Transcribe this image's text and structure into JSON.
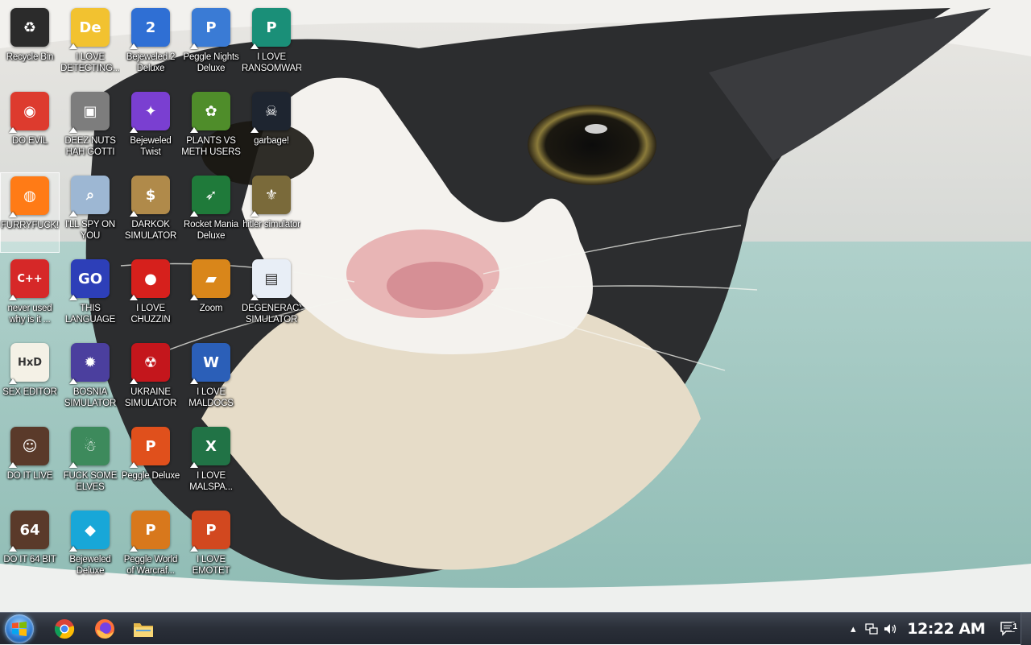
{
  "desktop": {
    "icons": [
      {
        "label": "Recycle Bin",
        "icon": "recycle-bin-icon",
        "color": "#2b2b2b",
        "glyph": "♻"
      },
      {
        "label": "DO EVIL",
        "icon": "chrome-icon",
        "color": "#dd3b2e",
        "glyph": "◉"
      },
      {
        "label": "FURRYFUCK!",
        "icon": "firefox-icon",
        "color": "#ff7b16",
        "glyph": "◍"
      },
      {
        "label": "never used\nwhy is it ...",
        "icon": "devcpp-icon",
        "color": "#d62828",
        "glyph": "C++"
      },
      {
        "label": "SEX EDITOR",
        "icon": "hxd-icon",
        "color": "#f4f1e6",
        "glyph": "HxD"
      },
      {
        "label": "DO IT LIVE",
        "icon": "portrait-icon",
        "color": "#5a3a2a",
        "glyph": "☺"
      },
      {
        "label": "DO IT 64 BIT",
        "icon": "portrait-64-icon",
        "color": "#5a3a2a",
        "glyph": "64"
      },
      {
        "label": "I LOVE\nDETECTING...",
        "icon": "detect-it-easy-icon",
        "color": "#f2c230",
        "glyph": "De"
      },
      {
        "label": "DEEZ NUTS\nHAH GOTTI",
        "icon": "windows-stack-icon",
        "color": "#7d7d7d",
        "glyph": "▣"
      },
      {
        "label": "I'LL SPY ON\nYOU",
        "icon": "spy-monitor-icon",
        "color": "#9db7d3",
        "glyph": "⌕"
      },
      {
        "label": "THIS\nLANGUAGE ...",
        "icon": "goland-icon",
        "color": "#2d3fb8",
        "glyph": "GO"
      },
      {
        "label": "BOSNIA\nSIMULATOR",
        "icon": "mine-icon",
        "color": "#4b3f9e",
        "glyph": "✹"
      },
      {
        "label": "FUCK SOME\nELVES",
        "icon": "elf-game-icon",
        "color": "#3d8a5c",
        "glyph": "☃"
      },
      {
        "label": "Bejeweled\nDeluxe",
        "icon": "diamond-icon",
        "color": "#18a7d8",
        "glyph": "◆"
      },
      {
        "label": "Bejeweled 2\nDeluxe",
        "icon": "bejeweled2-icon",
        "color": "#2f6fd4",
        "glyph": "2"
      },
      {
        "label": "Bejeweled\nTwist",
        "icon": "bejeweled-twist-icon",
        "color": "#7a3fd1",
        "glyph": "✦"
      },
      {
        "label": "DARKOK\nSIMULATOR",
        "icon": "money-bag-icon",
        "color": "#b08a4a",
        "glyph": "$"
      },
      {
        "label": "I LOVE\nCHUZZIN",
        "icon": "chuzzle-icon",
        "color": "#d6201c",
        "glyph": "●"
      },
      {
        "label": "UKRAINE\nSIMULATOR",
        "icon": "radiation-icon",
        "color": "#c4161c",
        "glyph": "☢"
      },
      {
        "label": "Peggle Deluxe",
        "icon": "peggle-icon",
        "color": "#e0501c",
        "glyph": "P"
      },
      {
        "label": "Peggle World\nof Warcraf...",
        "icon": "peggle-wow-icon",
        "color": "#d8781c",
        "glyph": "P"
      },
      {
        "label": "Peggle Nights\nDeluxe",
        "icon": "peggle-nights-icon",
        "color": "#3a7bd5",
        "glyph": "P"
      },
      {
        "label": "PLANTS VS\nMETH USERS",
        "icon": "plants-vs-zombies-icon",
        "color": "#4f8d2a",
        "glyph": "✿"
      },
      {
        "label": "Rocket Mania\nDeluxe",
        "icon": "rocket-icon",
        "color": "#1f7a3a",
        "glyph": "➶"
      },
      {
        "label": "Zoom",
        "icon": "zuma-icon",
        "color": "#d9861a",
        "glyph": "▰"
      },
      {
        "label": "I LOVE\nMALDOCS",
        "icon": "word-icon",
        "color": "#2b5fb8",
        "glyph": "W"
      },
      {
        "label": "I LOVE\nMALSPA...",
        "icon": "excel-icon",
        "color": "#217346",
        "glyph": "X"
      },
      {
        "label": "I LOVE\nEMOTET",
        "icon": "powerpoint-icon",
        "color": "#d2481f",
        "glyph": "P"
      },
      {
        "label": "I LOVE\nRANSOMWARE",
        "icon": "publisher-icon",
        "color": "#1a8f78",
        "glyph": "P"
      },
      {
        "label": "garbage!",
        "icon": "ghidra-icon",
        "color": "#1e2530",
        "glyph": "☠"
      },
      {
        "label": "hitler simulator",
        "icon": "coin-icon",
        "color": "#7a6a3a",
        "glyph": "⚜"
      },
      {
        "label": "DEGENERACY\nSIMULATOR",
        "icon": "app-window-icon",
        "color": "#e8eef6",
        "glyph": "▤"
      }
    ]
  },
  "taskbar": {
    "pinned": [
      {
        "name": "chrome",
        "icon": "chrome-icon"
      },
      {
        "name": "firefox",
        "icon": "firefox-icon"
      },
      {
        "name": "file-explorer",
        "icon": "folder-icon"
      }
    ],
    "tray": {
      "overflow_icon": "chevron-up-icon",
      "network_icon": "network-icon",
      "volume_icon": "volume-icon",
      "clock": "12:22 AM",
      "notification_count": "1"
    }
  },
  "colors": {
    "taskbar_bg": "#2a2f38",
    "selection": "rgba(255,255,255,0.32)"
  }
}
